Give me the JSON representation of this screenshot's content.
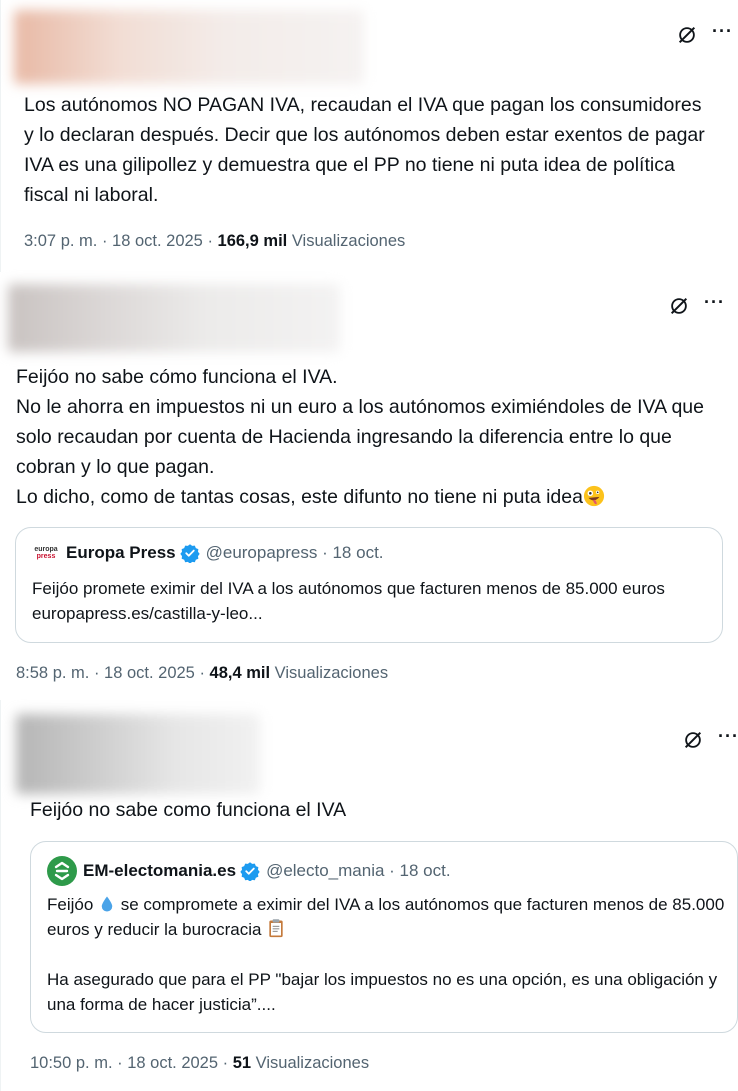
{
  "tweets": [
    {
      "text": "Los autónomos NO PAGAN IVA, recaudan el IVA que pagan los consumidores y lo declaran después. Decir que los autónomos deben estar exentos de pagar IVA es una gilipollez y demuestra que el PP no tiene ni puta idea de política fiscal ni laboral.",
      "time": "3:07 p. m. · 18 oct. 2025 · ",
      "views_count": "166,9 mil",
      "views_label": " Visualizaciones"
    },
    {
      "text": "Feijóo no sabe cómo funciona el IVA.\nNo le ahorra en impuestos ni un euro a los autónomos eximiéndoles de IVA que solo recaudan por cuenta de Hacienda ingresando la diferencia entre lo que cobran y lo que pagan.\nLo dicho, como de tantas cosas, este difunto no tiene ni puta idea",
      "quote": {
        "logo_top": "europa",
        "logo_bottom": "press",
        "name": "Europa Press",
        "handle": "@europapress · 18 oct.",
        "text": "Feijóo promete eximir del IVA a los autónomos que facturen menos de 85.000 euros europapress.es/castilla-y-leo..."
      },
      "time": "8:58 p. m. · 18 oct. 2025 · ",
      "views_count": "48,4 mil",
      "views_label": " Visualizaciones"
    },
    {
      "text": "Feijóo no sabe como funciona el IVA",
      "quote": {
        "name": "EM-electomania.es",
        "handle": "@electo_mania · 18 oct.",
        "text_a": "Feijóo ",
        "text_b": " se compromete a eximir del IVA a los autónomos que facturen menos de 85.000 euros y reducir la burocracia ",
        "text_c": "Ha asegurado que para el PP \"bajar los impuestos no es una opción, es una obligación y una forma de hacer justicia”...."
      },
      "time": "10:50 p. m. · 18 oct. 2025 · ",
      "views_count": "51",
      "views_label": " Visualizaciones"
    }
  ],
  "icons": [
    "grok-icon",
    "more-icon",
    "verified-badge-icon",
    "zany-face-emoji",
    "droplet-emoji",
    "clipboard-emoji"
  ],
  "colors": {
    "verified": "#1d9bf0",
    "secondary_text": "#536471",
    "em_green": "#2e9a4a"
  }
}
